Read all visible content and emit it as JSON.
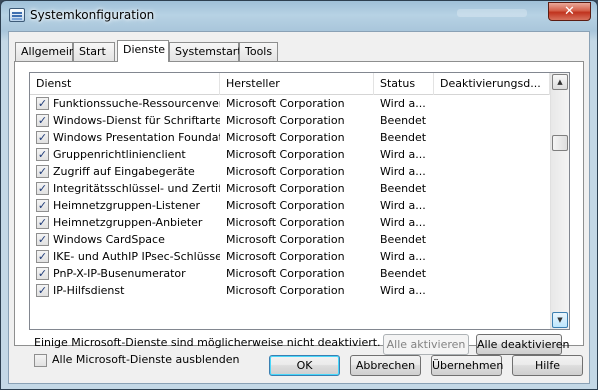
{
  "window": {
    "title": "Systemkonfiguration",
    "close_glyph": "✕"
  },
  "tabs": [
    {
      "label": "Allgemein",
      "active": false
    },
    {
      "label": "Start",
      "active": false
    },
    {
      "label": "Dienste",
      "active": true
    },
    {
      "label": "Systemstart",
      "active": false
    },
    {
      "label": "Tools",
      "active": false
    }
  ],
  "table": {
    "columns": [
      "Dienst",
      "Hersteller",
      "Status",
      "Deaktivierungsd..."
    ],
    "rows": [
      {
        "checked": true,
        "name": "Funktionssuche-Ressourcenverö...",
        "maker": "Microsoft Corporation",
        "status": "Wird a...",
        "date": ""
      },
      {
        "checked": true,
        "name": "Windows-Dienst für Schriftarten...",
        "maker": "Microsoft Corporation",
        "status": "Beendet",
        "date": ""
      },
      {
        "checked": true,
        "name": "Windows Presentation Foundati...",
        "maker": "Microsoft Corporation",
        "status": "Beendet",
        "date": ""
      },
      {
        "checked": true,
        "name": "Gruppenrichtlinienclient",
        "maker": "Microsoft Corporation",
        "status": "Wird a...",
        "date": ""
      },
      {
        "checked": true,
        "name": "Zugriff auf Eingabegeräte",
        "maker": "Microsoft Corporation",
        "status": "Wird a...",
        "date": ""
      },
      {
        "checked": true,
        "name": "Integritätsschlüssel- und Zertifik...",
        "maker": "Microsoft Corporation",
        "status": "Beendet",
        "date": ""
      },
      {
        "checked": true,
        "name": "Heimnetzgruppen-Listener",
        "maker": "Microsoft Corporation",
        "status": "Wird a...",
        "date": ""
      },
      {
        "checked": true,
        "name": "Heimnetzgruppen-Anbieter",
        "maker": "Microsoft Corporation",
        "status": "Wird a...",
        "date": ""
      },
      {
        "checked": true,
        "name": "Windows CardSpace",
        "maker": "Microsoft Corporation",
        "status": "Beendet",
        "date": ""
      },
      {
        "checked": true,
        "name": "IKE- und AuthIP IPsec-Schlüssel...",
        "maker": "Microsoft Corporation",
        "status": "Wird a...",
        "date": ""
      },
      {
        "checked": true,
        "name": "PnP-X-IP-Busenumerator",
        "maker": "Microsoft Corporation",
        "status": "Beendet",
        "date": ""
      },
      {
        "checked": true,
        "name": "IP-Hilfsdienst",
        "maker": "Microsoft Corporation",
        "status": "Wird a...",
        "date": ""
      }
    ]
  },
  "note": "Einige Microsoft-Dienste sind möglicherweise nicht deaktiviert.",
  "buttons": {
    "enable_all": "Alle aktivieren",
    "disable_all": "Alle deaktivieren",
    "ok": "OK",
    "cancel": "Abbrechen",
    "apply": "Übernehmen",
    "help": "Hilfe"
  },
  "hide_ms": {
    "label": "Alle Microsoft-Dienste ausblenden",
    "checked": false
  },
  "icons": {
    "checkmark": "✓",
    "scroll_up": "▲",
    "scroll_down": "▼"
  }
}
